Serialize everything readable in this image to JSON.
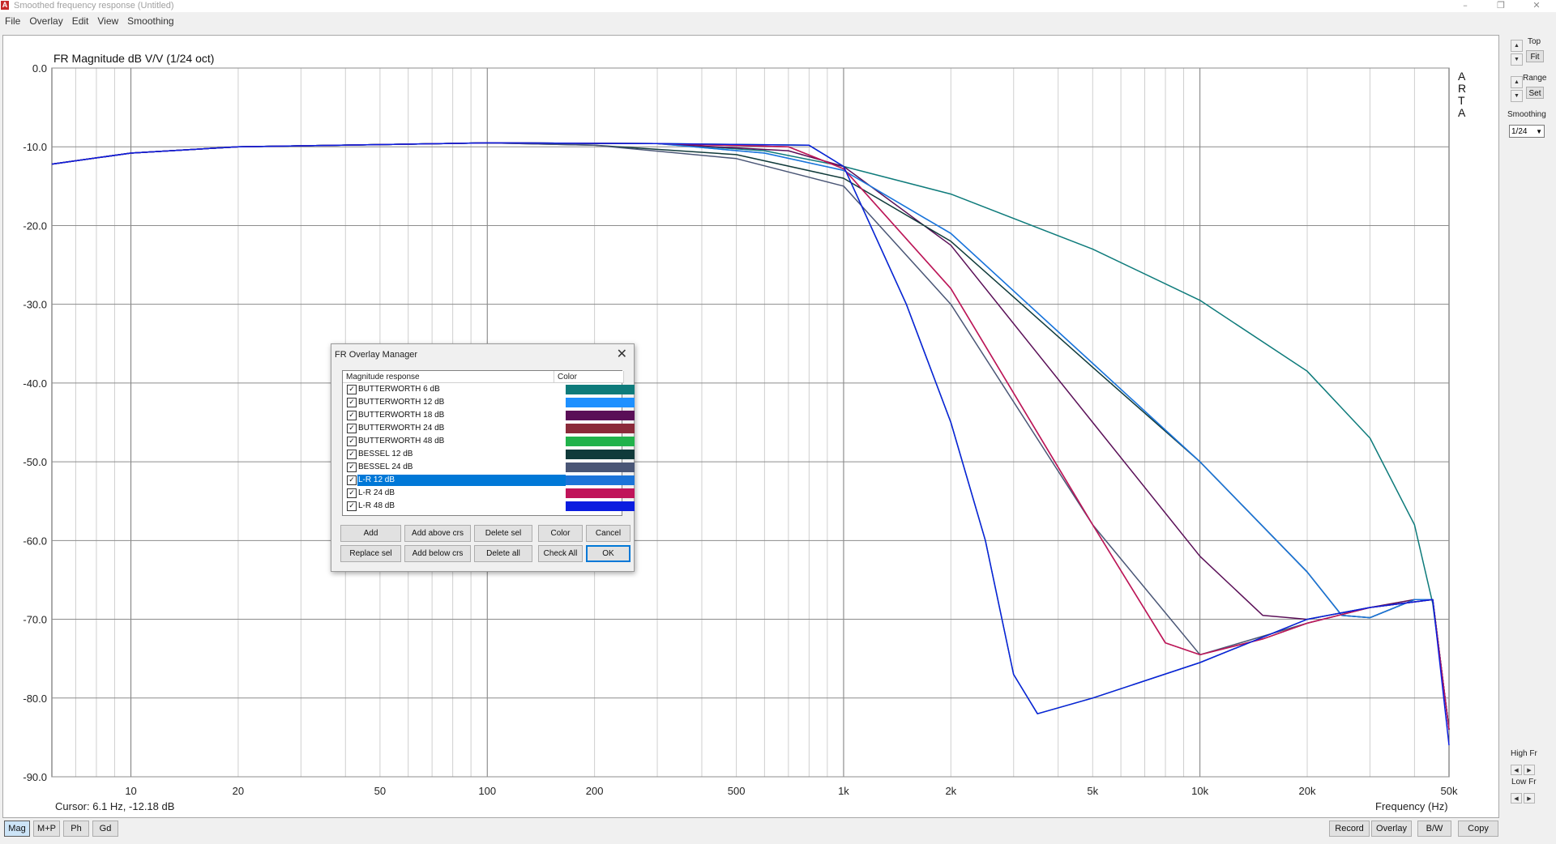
{
  "window": {
    "title": "Smoothed frequency response (Untitled)",
    "app_icon": "arta-app-icon",
    "controls": [
      "–",
      "❐",
      "✕"
    ]
  },
  "menu": [
    "File",
    "Overlay",
    "Edit",
    "View",
    "Smoothing"
  ],
  "side_letters": [
    "A",
    "R",
    "T",
    "A"
  ],
  "plot": {
    "cursor_text": "Cursor: 6.1 Hz, -12.18 dB",
    "xlabel": "Frequency (Hz)"
  },
  "chart_data": {
    "type": "line",
    "title": "FR Magnitude dB V/V (1/24 oct)",
    "xlabel": "Frequency (Hz)",
    "ylabel": "",
    "x_scale": "log",
    "xlim": [
      6,
      50000
    ],
    "ylim": [
      -90,
      0
    ],
    "grid": true,
    "y_ticks": [
      "0.0",
      "-10.0",
      "-20.0",
      "-30.0",
      "-40.0",
      "-50.0",
      "-60.0",
      "-70.0",
      "-80.0",
      "-90.0"
    ],
    "x_ticks": [
      {
        "v": 10,
        "label": "10"
      },
      {
        "v": 20,
        "label": "20"
      },
      {
        "v": 50,
        "label": "50"
      },
      {
        "v": 100,
        "label": "100"
      },
      {
        "v": 200,
        "label": "200"
      },
      {
        "v": 500,
        "label": "500"
      },
      {
        "v": 1000,
        "label": "1k"
      },
      {
        "v": 2000,
        "label": "2k"
      },
      {
        "v": 5000,
        "label": "5k"
      },
      {
        "v": 10000,
        "label": "10k"
      },
      {
        "v": 20000,
        "label": "20k"
      },
      {
        "v": 50000,
        "label": "50k"
      }
    ],
    "series": [
      {
        "name": "BUTTERWORTH 6 dB",
        "color": "#0e7b7b",
        "points": [
          [
            6,
            -12.2
          ],
          [
            10,
            -10.8
          ],
          [
            20,
            -10
          ],
          [
            100,
            -9.5
          ],
          [
            300,
            -9.6
          ],
          [
            600,
            -10.5
          ],
          [
            1000,
            -12.5
          ],
          [
            2000,
            -16
          ],
          [
            5000,
            -23
          ],
          [
            10000,
            -29.5
          ],
          [
            20000,
            -38.5
          ],
          [
            30000,
            -47
          ],
          [
            40000,
            -58
          ],
          [
            45000,
            -68
          ],
          [
            50000,
            -84
          ]
        ]
      },
      {
        "name": "BUTTERWORTH 12 dB",
        "color": "#1e90ff",
        "points": [
          [
            6,
            -12.2
          ],
          [
            10,
            -10.8
          ],
          [
            20,
            -10
          ],
          [
            100,
            -9.5
          ],
          [
            300,
            -9.6
          ],
          [
            600,
            -10.8
          ],
          [
            1000,
            -13
          ],
          [
            2000,
            -21
          ],
          [
            5000,
            -37.5
          ],
          [
            10000,
            -50
          ],
          [
            20000,
            -64
          ],
          [
            25000,
            -69.5
          ],
          [
            30000,
            -69.8
          ],
          [
            40000,
            -67.5
          ],
          [
            45000,
            -67.5
          ],
          [
            50000,
            -84
          ]
        ]
      },
      {
        "name": "BUTTERWORTH 18 dB",
        "color": "#5a0f57",
        "points": [
          [
            6,
            -12.2
          ],
          [
            10,
            -10.8
          ],
          [
            20,
            -10
          ],
          [
            100,
            -9.5
          ],
          [
            300,
            -9.6
          ],
          [
            700,
            -10.5
          ],
          [
            1000,
            -12.5
          ],
          [
            2000,
            -22.5
          ],
          [
            5000,
            -45
          ],
          [
            10000,
            -62
          ],
          [
            15000,
            -69.5
          ],
          [
            20000,
            -70
          ],
          [
            30000,
            -68.5
          ],
          [
            40000,
            -67.5
          ],
          [
            45000,
            -67.5
          ],
          [
            50000,
            -84
          ]
        ]
      },
      {
        "name": "BUTTERWORTH 24 dB",
        "color": "#8b2a3a",
        "points": [
          [
            6,
            -12.2
          ],
          [
            10,
            -10.8
          ],
          [
            20,
            -10
          ],
          [
            100,
            -9.5
          ],
          [
            300,
            -9.6
          ],
          [
            700,
            -10
          ],
          [
            1000,
            -12.8
          ],
          [
            2000,
            -28
          ],
          [
            5000,
            -58
          ],
          [
            8000,
            -73
          ],
          [
            10000,
            -74.5
          ],
          [
            15000,
            -72.5
          ],
          [
            20000,
            -70.5
          ],
          [
            30000,
            -68.5
          ],
          [
            45000,
            -67.5
          ],
          [
            50000,
            -84
          ]
        ]
      },
      {
        "name": "BUTTERWORTH 48 dB",
        "color": "#21b24b",
        "points": [
          [
            6,
            -12.2
          ],
          [
            10,
            -10.8
          ],
          [
            20,
            -10
          ],
          [
            100,
            -9.5
          ],
          [
            300,
            -9.6
          ],
          [
            800,
            -9.8
          ],
          [
            1000,
            -12.5
          ],
          [
            1500,
            -30
          ],
          [
            2000,
            -45
          ],
          [
            2500,
            -60
          ],
          [
            3000,
            -77
          ],
          [
            3500,
            -82
          ],
          [
            5000,
            -80
          ],
          [
            10000,
            -75.5
          ],
          [
            20000,
            -70
          ],
          [
            30000,
            -68.5
          ],
          [
            45000,
            -67.5
          ],
          [
            50000,
            -84
          ]
        ]
      },
      {
        "name": "BESSEL 12 dB",
        "color": "#103a3a",
        "points": [
          [
            6,
            -12.2
          ],
          [
            10,
            -10.8
          ],
          [
            20,
            -10
          ],
          [
            100,
            -9.5
          ],
          [
            200,
            -9.8
          ],
          [
            500,
            -11
          ],
          [
            1000,
            -14
          ],
          [
            2000,
            -22
          ],
          [
            5000,
            -38
          ],
          [
            10000,
            -50
          ],
          [
            20000,
            -64
          ],
          [
            25000,
            -69.5
          ],
          [
            30000,
            -69.8
          ],
          [
            40000,
            -67.5
          ],
          [
            45000,
            -67.5
          ],
          [
            50000,
            -84
          ]
        ]
      },
      {
        "name": "BESSEL 24 dB",
        "color": "#4a5676",
        "points": [
          [
            6,
            -12.2
          ],
          [
            10,
            -10.8
          ],
          [
            20,
            -10
          ],
          [
            100,
            -9.5
          ],
          [
            200,
            -9.8
          ],
          [
            500,
            -11.5
          ],
          [
            1000,
            -15
          ],
          [
            2000,
            -30
          ],
          [
            5000,
            -58
          ],
          [
            10000,
            -74.5
          ],
          [
            20000,
            -70.5
          ],
          [
            30000,
            -68.5
          ],
          [
            45000,
            -67.5
          ],
          [
            50000,
            -84
          ]
        ]
      },
      {
        "name": "L-R 12 dB",
        "color": "#1c74d9",
        "points": [
          [
            6,
            -12.2
          ],
          [
            10,
            -10.8
          ],
          [
            20,
            -10
          ],
          [
            100,
            -9.5
          ],
          [
            300,
            -9.6
          ],
          [
            600,
            -10.8
          ],
          [
            1000,
            -13
          ],
          [
            2000,
            -21
          ],
          [
            5000,
            -37.5
          ],
          [
            10000,
            -50
          ],
          [
            20000,
            -64
          ],
          [
            25000,
            -69.5
          ],
          [
            30000,
            -69.8
          ],
          [
            40000,
            -67.5
          ],
          [
            45000,
            -67.5
          ],
          [
            50000,
            -84
          ]
        ]
      },
      {
        "name": "L-R 24 dB",
        "color": "#c0145a",
        "points": [
          [
            6,
            -12.2
          ],
          [
            10,
            -10.8
          ],
          [
            20,
            -10
          ],
          [
            100,
            -9.5
          ],
          [
            300,
            -9.6
          ],
          [
            700,
            -10
          ],
          [
            1000,
            -12.8
          ],
          [
            2000,
            -28
          ],
          [
            5000,
            -58
          ],
          [
            8000,
            -73
          ],
          [
            10000,
            -74.5
          ],
          [
            15000,
            -72.5
          ],
          [
            20000,
            -70.5
          ],
          [
            30000,
            -68.5
          ],
          [
            45000,
            -67.5
          ],
          [
            50000,
            -84
          ]
        ]
      },
      {
        "name": "L-R 48 dB",
        "color": "#0b1de0",
        "points": [
          [
            6,
            -12.2
          ],
          [
            10,
            -10.8
          ],
          [
            20,
            -10
          ],
          [
            100,
            -9.5
          ],
          [
            300,
            -9.6
          ],
          [
            800,
            -9.8
          ],
          [
            1000,
            -12.5
          ],
          [
            1500,
            -30
          ],
          [
            2000,
            -45
          ],
          [
            2500,
            -60
          ],
          [
            3000,
            -77
          ],
          [
            3500,
            -82
          ],
          [
            5000,
            -80
          ],
          [
            10000,
            -75.5
          ],
          [
            20000,
            -70
          ],
          [
            30000,
            -68.5
          ],
          [
            45000,
            -67.5
          ],
          [
            50000,
            -86
          ]
        ]
      }
    ]
  },
  "right_panel": {
    "top_label": "Top",
    "fit_label": "Fit",
    "range_label": "Range",
    "set_label": "Set",
    "smoothing_label": "Smoothing",
    "smoothing_value": "1/24",
    "highfr_label": "High Fr",
    "lowfr_label": "Low Fr"
  },
  "bottom_left": [
    "Mag",
    "M+P",
    "Ph",
    "Gd"
  ],
  "bottom_right": [
    "Record",
    "Overlay",
    "B/W",
    "Copy"
  ],
  "dialog": {
    "title": "FR Overlay Manager",
    "col_name": "Magnitude response",
    "col_color": "Color",
    "rows": [
      {
        "name": "BUTTERWORTH 6 dB",
        "color": "#0e7b7b",
        "checked": "✓"
      },
      {
        "name": "BUTTERWORTH 12 dB",
        "color": "#1e90ff",
        "checked": "✓"
      },
      {
        "name": "BUTTERWORTH 18 dB",
        "color": "#5a0f57",
        "checked": "✓"
      },
      {
        "name": "BUTTERWORTH 24 dB",
        "color": "#8b2a3a",
        "checked": "✓"
      },
      {
        "name": "BUTTERWORTH 48 dB",
        "color": "#21b24b",
        "checked": "✓"
      },
      {
        "name": "BESSEL 12 dB",
        "color": "#103a3a",
        "checked": "✓"
      },
      {
        "name": "BESSEL 24 dB",
        "color": "#4a5676",
        "checked": "✓"
      },
      {
        "name": "L-R 12 dB",
        "color": "#1c74d9",
        "checked": "✓",
        "selected": true
      },
      {
        "name": "L-R 24 dB",
        "color": "#c0145a",
        "checked": "✓"
      },
      {
        "name": "L-R 48 dB",
        "color": "#0b1de0",
        "checked": "✓"
      }
    ],
    "buttons_row1": [
      "Add",
      "Add above crs",
      "Delete sel",
      "Color",
      "Cancel"
    ],
    "buttons_row2": [
      "Replace sel",
      "Add below crs",
      "Delete all",
      "Check All",
      "OK"
    ]
  }
}
